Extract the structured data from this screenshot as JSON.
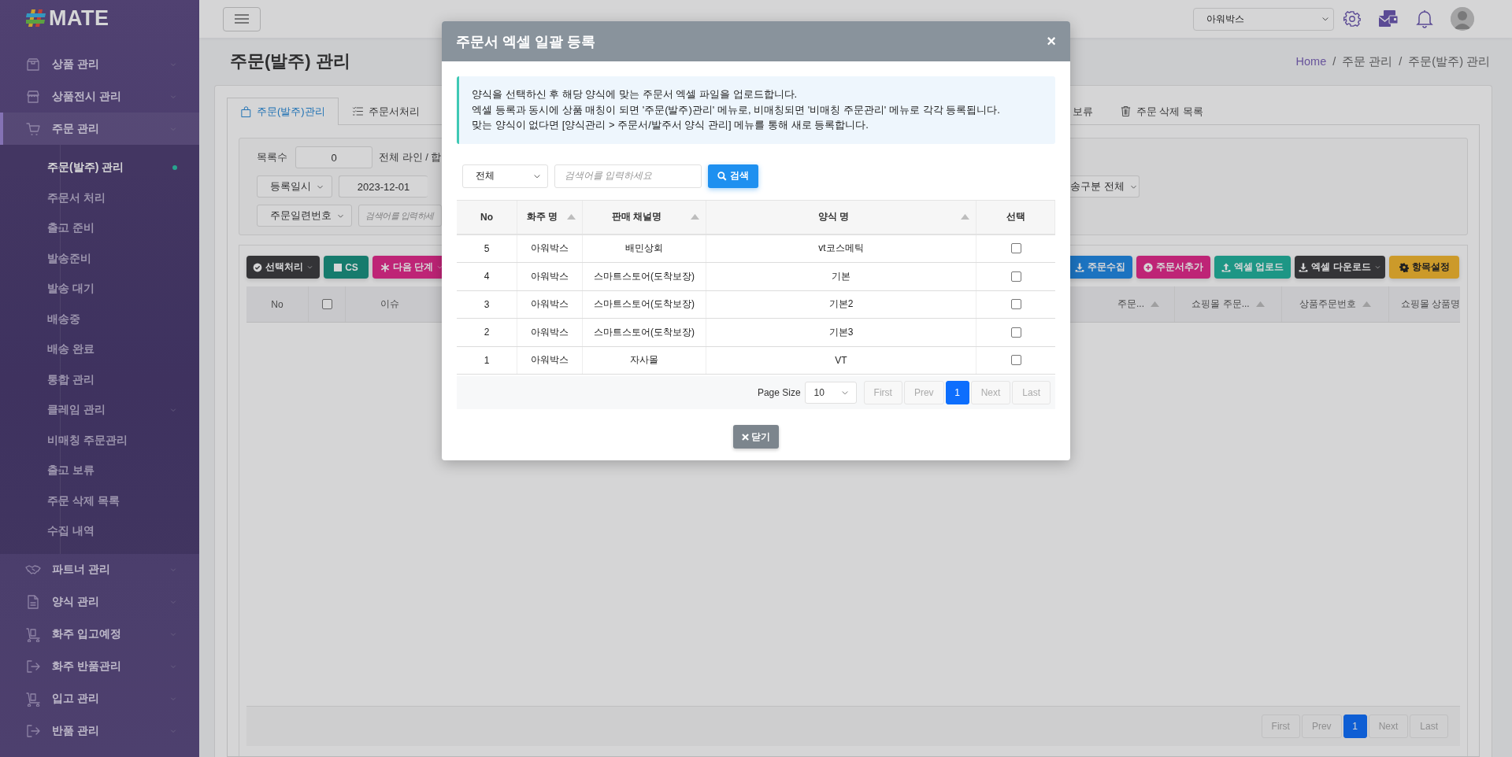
{
  "sidebar": {
    "logo": "MATE",
    "items": [
      {
        "label": "상품 관리",
        "selected": false
      },
      {
        "label": "상품전시 관리",
        "selected": false
      },
      {
        "label": "주문 관리",
        "selected": true,
        "children": [
          {
            "label": "주문(발주) 관리",
            "kind": "link",
            "selected": true
          },
          {
            "label": "주문서 처리",
            "kind": "link",
            "selected": false
          },
          {
            "label": "출고 준비",
            "kind": "link",
            "selected": false
          },
          {
            "label": "발송준비",
            "kind": "link",
            "selected": false
          },
          {
            "label": "발송 대기",
            "kind": "link",
            "selected": false
          },
          {
            "label": "배송중",
            "kind": "link",
            "selected": false
          },
          {
            "label": "배송 완료",
            "kind": "link",
            "selected": false
          },
          {
            "label": "통합 관리",
            "kind": "link",
            "selected": false
          },
          {
            "label": "클레임 관리",
            "kind": "group",
            "selected": false
          },
          {
            "label": "비매칭 주문관리",
            "kind": "link",
            "selected": false
          },
          {
            "label": "출고 보류",
            "kind": "link",
            "selected": false
          },
          {
            "label": "주문 삭제 목록",
            "kind": "link",
            "selected": false
          },
          {
            "label": "수집 내역",
            "kind": "link",
            "selected": false
          }
        ]
      },
      {
        "label": "파트너 관리",
        "selected": false
      },
      {
        "label": "양식 관리",
        "selected": false
      },
      {
        "label": "화주 입고예정",
        "selected": false
      },
      {
        "label": "화주 반품관리",
        "selected": false
      },
      {
        "label": "입고 관리",
        "selected": false
      },
      {
        "label": "반품 관리",
        "selected": false
      }
    ]
  },
  "topbar": {
    "company": "아워박스"
  },
  "page": {
    "title": "주문(발주) 관리",
    "breadcrumb": [
      {
        "kind": "link",
        "label": "Home"
      },
      {
        "kind": "separator",
        "label": "/"
      },
      {
        "kind": "link",
        "label": "주문 관리"
      },
      {
        "kind": "separator",
        "label": "/"
      },
      {
        "kind": "current",
        "label": "주문(발주) 관리"
      }
    ]
  },
  "tabs_left": [
    {
      "label": "주문(발주)관리",
      "selected": true
    },
    {
      "label": "주문서처리",
      "selected": false
    }
  ],
  "tabs_right": [
    {
      "label": "보류",
      "selected": false
    },
    {
      "label": "주문 삭제 목록",
      "selected": false
    }
  ],
  "filters": {
    "count_label": "목록수",
    "count_value": "0",
    "total_label": "전체 라인 / 합",
    "date_type": "등록일시",
    "date_from": "2023-12-01",
    "shipping_type": "송구분 전체",
    "search_type": "주문일련번호",
    "search_placeholder": "검색어를 입력하세"
  },
  "toolbar_left": [
    {
      "label": "선택처리",
      "kind": "dark",
      "dropdown": true
    },
    {
      "label": "CS",
      "kind": "teal",
      "dropdown": false
    },
    {
      "label": "다음 단계",
      "kind": "pink",
      "dropdown": true
    }
  ],
  "toolbar_right": [
    {
      "label": "주문수집",
      "kind": "blue",
      "dropdown": false
    },
    {
      "label": "주문서추가",
      "kind": "pink",
      "dropdown": false
    },
    {
      "label": "엑셀 업로드",
      "kind": "green",
      "dropdown": false
    },
    {
      "label": "엑셀 다운로드",
      "kind": "dark",
      "dropdown": true
    },
    {
      "label": "항목설정",
      "kind": "yellow",
      "dropdown": false
    }
  ],
  "table": {
    "columns_left": [
      "No",
      "이슈"
    ],
    "select_all": {
      "checked": false
    },
    "columns_right": [
      "주문...",
      "쇼핑몰 주문...",
      "상품주문번호",
      "쇼핑몰 상품명"
    ]
  },
  "pagination": [
    {
      "label": "First",
      "selected": false
    },
    {
      "label": "Prev",
      "selected": false
    },
    {
      "label": "1",
      "selected": true
    },
    {
      "label": "Next",
      "selected": false
    },
    {
      "label": "Last",
      "selected": false
    }
  ],
  "modal": {
    "title": "주문서 엑셀 일괄 등록",
    "close": "×",
    "notice": [
      "양식을 선택하신 후 해당 양식에 맞는 주문서 엑셀 파일을 업로드합니다.",
      "엑셀 등록과 동시에 상품 매칭이 되면 '주문(발주)관리' 메뉴로, 비매칭되면 '비매칭 주문관리' 메뉴로 각각 등록됩니다.",
      "맞는 양식이 없다면 [양식관리 > 주문서/발주서 양식 관리] 메뉴를 통해 새로 등록합니다."
    ],
    "filter_select": "전체",
    "search_placeholder": "검색어를 입력하세요",
    "search_button": "검색",
    "columns": [
      {
        "label": "No",
        "sortable": false
      },
      {
        "label": "화주 명",
        "sortable": true
      },
      {
        "label": "판매 채널명",
        "sortable": true
      },
      {
        "label": "양식 명",
        "sortable": true
      },
      {
        "label": "선택",
        "sortable": false
      }
    ],
    "rows": [
      {
        "no": "5",
        "owner": "아워박스",
        "channel": "배민상회",
        "form": "vt코스메틱",
        "checked": false
      },
      {
        "no": "4",
        "owner": "아워박스",
        "channel": "스마트스토어(도착보장)",
        "form": "기본",
        "checked": false
      },
      {
        "no": "3",
        "owner": "아워박스",
        "channel": "스마트스토어(도착보장)",
        "form": "기본2",
        "checked": false
      },
      {
        "no": "2",
        "owner": "아워박스",
        "channel": "스마트스토어(도착보장)",
        "form": "기본3",
        "checked": false
      },
      {
        "no": "1",
        "owner": "아워박스",
        "channel": "자사몰",
        "form": "VT",
        "checked": false
      }
    ],
    "page_size_label": "Page Size",
    "page_size": "10",
    "pagination": [
      {
        "label": "First",
        "selected": false
      },
      {
        "label": "Prev",
        "selected": false
      },
      {
        "label": "1",
        "selected": true
      },
      {
        "label": "Next",
        "selected": false
      },
      {
        "label": "Last",
        "selected": false
      }
    ],
    "close_button": "닫기"
  }
}
